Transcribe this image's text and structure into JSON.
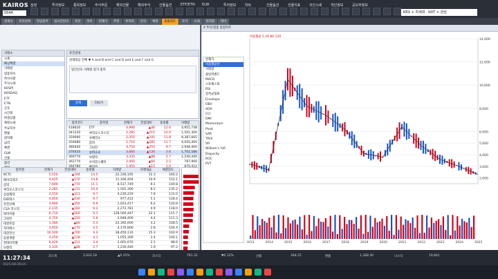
{
  "app": {
    "logo": "KAIROS",
    "code": "0544"
  },
  "menu": [
    "설정",
    "투자정보",
    "종목정보",
    "주식주문",
    "해외선물",
    "해외주식",
    "선물옵션",
    "ETF/ETN",
    "ELW",
    "투자정보",
    "차트",
    "선물옵션",
    "선물지표",
    "코인시세",
    "개인정보",
    "공모주정보"
  ],
  "search_text": "KRX + 차세대 · NXT + 관심",
  "tabs": [
    "검색식",
    "조건검색",
    "관심종목",
    "실시간잔고",
    "조건",
    "차트",
    "현재가",
    "주문",
    "투자자",
    "잔고",
    "체결",
    "종합차트",
    "호가",
    "시세",
    "일자별",
    "테마"
  ],
  "tree": {
    "title": "거래소",
    "items": [
      "시세",
      "예상체결",
      "거래량",
      "업종지수",
      "특이사항",
      "주식시세",
      "KOSPI",
      "KOSDAQ",
      "ETF",
      "ETN",
      "신호",
      "시간외",
      "파생상품",
      "해외시세",
      "주요지수",
      "환율",
      "원자재",
      "금리",
      "채권",
      "ELW",
      "선물",
      "옵션",
      "테마",
      "관심종목"
    ]
  },
  "filter": {
    "title": "조건검색",
    "line1": "검색대상 전체 ▼  A and B and C and D and E and F and G",
    "line2": "일간신호 거래량 증가 종목",
    "search_btn": "검색",
    "more_btn": "더보기"
  },
  "grid": {
    "headers": [
      "종목코드",
      "종목명",
      "현재가",
      "전일대비",
      "등락률",
      "거래량"
    ],
    "rows": [
      [
        "418620",
        "ETF",
        "4,990",
        "▲40",
        "12.0",
        "4,955,738"
      ],
      [
        "341220",
        "쿠리오스코스닥",
        "2,285",
        "▲215",
        "12.0",
        "1,501,300"
      ],
      [
        "359090",
        "슈페리소",
        "2,355",
        "▲245",
        "11.8",
        "8,387,665"
      ],
      [
        "356680",
        "잠자",
        "2,710",
        "▲285",
        "11.7",
        "4,045,400"
      ],
      [
        "380440",
        "그린킨",
        "4,750",
        "▲255",
        "9.7",
        "2,948,400"
      ],
      [
        "376410",
        "슈퍼소호",
        "3,660",
        "▲130",
        "3.6",
        "1,702,586"
      ],
      [
        "369770",
        "보잘리",
        "3,335",
        "▲88",
        "2.7",
        "1,230,440"
      ],
      [
        "362770",
        "수석한스퀘어",
        "2,400",
        "▲60",
        "2.5",
        "787,900"
      ],
      [
        "394780",
        "빠자한",
        "1,455",
        "▲15",
        "1.0",
        "870,412"
      ],
      [
        "388530",
        "프리텍",
        "5,025",
        "▲45",
        "0.9",
        "1,000,417"
      ],
      [
        "298080",
        "자산",
        "5,730",
        "▲20",
        "0.3",
        "812,250"
      ]
    ]
  },
  "bottom": {
    "headers": [
      "종목명",
      "현재가",
      "전일대비",
      "등락률",
      "거래량",
      "거래대금",
      "체결강도"
    ],
    "rows": [
      [
        "KCTC",
        "5,550",
        "▲704",
        "14.5",
        "22,330,195",
        "12.3",
        "160.2"
      ],
      [
        "에이디테크",
        "4,425",
        "▲570",
        "14.8",
        "11,160,404",
        "10.9",
        "152.1"
      ],
      [
        "삼익",
        "7,690",
        "▲770",
        "11.1",
        "8,517,749",
        "9.1",
        "140.8"
      ],
      [
        "쿠리오스코스닥",
        "2,285",
        "▲215",
        "10.4",
        "1,501,300",
        "8.5",
        "135.2"
      ],
      [
        "삼성제약",
        "3,550",
        "▲313",
        "9.7",
        "4,230,220",
        "7.8",
        "131.0"
      ],
      [
        "DID텍스",
        "4,850",
        "▲430",
        "9.7",
        "977,412",
        "5.1",
        "128.4"
      ],
      [
        "유진인베",
        "3,960",
        "▲356",
        "9.9",
        "1,023,417",
        "6.2",
        "120.8"
      ],
      [
        "CSA 코스믹",
        "2,135",
        "▲182",
        "9.3",
        "2,272,781",
        "4.9",
        "118.0"
      ],
      [
        "와이어블",
        "6,710",
        "▲560",
        "9.1",
        "128,500,447",
        "22.1",
        "115.7"
      ],
      [
        "그린킨",
        "4,750",
        "▲250",
        "5.6",
        "2,948,400",
        "4.4",
        "111.3"
      ],
      [
        "대영포장",
        "1,580",
        "▲80",
        "5.3",
        "22,392,000",
        "3.2",
        "108.5"
      ],
      [
        "자이에스",
        "3,950",
        "▲170",
        "4.5",
        "4,170,800",
        "2.8",
        "104.4"
      ],
      [
        "대한전선",
        "16,500",
        "▲700",
        "4.4",
        "38,450,110",
        "15.3",
        "102.9"
      ],
      [
        "동원개발",
        "3,250",
        "▲128",
        "4.1",
        "1,055,300",
        "2.4",
        "100.1"
      ],
      [
        "현대이지웰",
        "6,420",
        "▲211",
        "3.4",
        "2,001,070",
        "2.1",
        "98.6"
      ],
      [
        "보잘리",
        "3,335",
        "▲88",
        "2.7",
        "1,230,440",
        "1.9",
        "97.2"
      ],
      [
        "BS",
        "4,535",
        "▲84",
        "1.9",
        "1,988,108",
        "1.5",
        "95.0"
      ]
    ]
  },
  "chart_data": {
    "type": "line",
    "title": "4 주식/업종 종합차트",
    "ylim": [
      1500,
      14000
    ],
    "x": [
      "2013",
      "2014",
      "2015",
      "2016",
      "2017",
      "2018",
      "2019",
      "2020",
      "2021",
      "2022",
      "2023",
      "2024",
      "2025"
    ],
    "series": [
      {
        "name": "종가",
        "values": [
          3200,
          2700,
          10500,
          8200,
          7400,
          6200,
          4100,
          3800,
          6400,
          4800,
          3600,
          3000,
          2300
        ]
      }
    ],
    "ticks": [
      "14,000",
      "12,000",
      "10,000",
      "8,000",
      "6,000",
      "5,000",
      "4,000",
      "3,000",
      "2,000"
    ],
    "indicators": [
      "현재가",
      "이동평균선",
      "거래량",
      "볼린저밴드",
      "MACD",
      "스토캐스틱",
      "RSI",
      "일목균형표",
      "Envelope",
      "OBV",
      "ADX",
      "CCI",
      "DMI",
      "Momentum",
      "Pivot",
      "SAR",
      "TRIX",
      "VR",
      "William's %R",
      "Disparity",
      "ROC",
      "PVT"
    ],
    "legend": "이동평균 5 20 60 120"
  },
  "status": {
    "time": "11:27:34",
    "date": "2025-08-29(금)",
    "items": [
      "코스피",
      "2,624.18",
      "▲0.35%",
      "코스닥",
      "781.32",
      "▼0.12%",
      "선물",
      "348.25",
      "환율",
      "1,388.40",
      "나스닥",
      "19,841"
    ]
  }
}
